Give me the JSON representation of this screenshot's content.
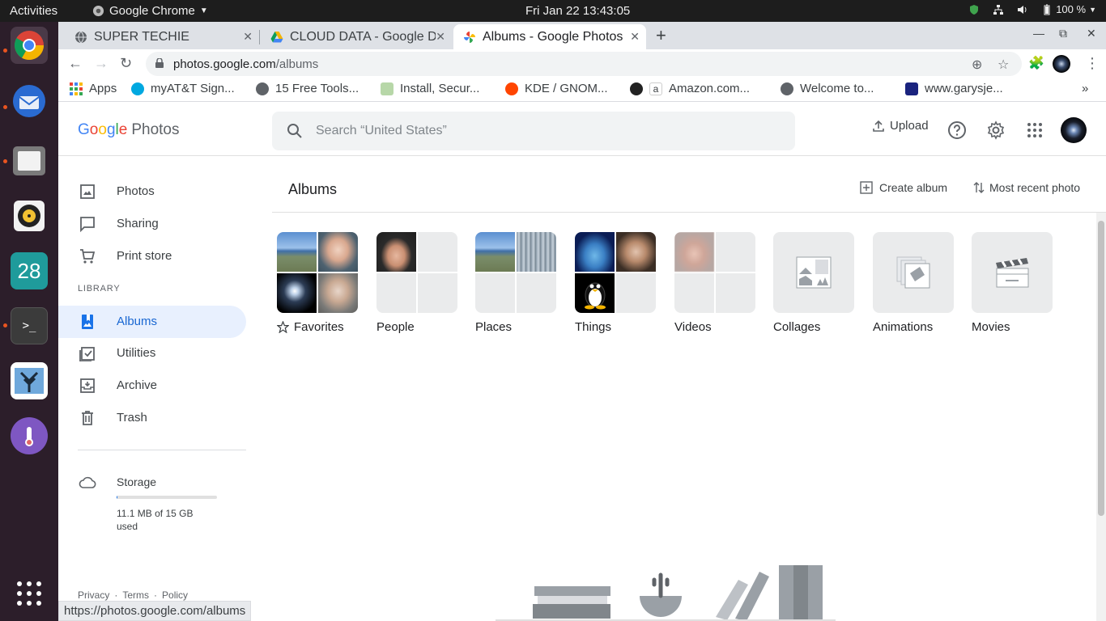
{
  "system": {
    "activities": "Activities",
    "app_menu": "Google Chrome",
    "clock": "Fri Jan 22  13:43:05",
    "battery": "100 %"
  },
  "dock": {
    "items": [
      "chrome-icon",
      "thunderbird-icon",
      "files-icon",
      "rhythmbox-icon",
      "calendar-icon",
      "terminal-icon",
      "photos-tree-icon",
      "thermometer-icon"
    ],
    "calendar_day": "28"
  },
  "tabs": [
    {
      "title": "SUPER TECHIE"
    },
    {
      "title": "CLOUD DATA - Google Drive"
    },
    {
      "title": "Albums - Google Photos"
    }
  ],
  "toolbar": {
    "url_host": "photos.google.com",
    "url_path": "/albums"
  },
  "bookmarks": [
    {
      "label": "Apps"
    },
    {
      "label": "myAT&T Sign..."
    },
    {
      "label": "15 Free Tools..."
    },
    {
      "label": "Install, Secur..."
    },
    {
      "label": "KDE / GNOM..."
    },
    {
      "label": "Amazon.com..."
    },
    {
      "label": "Welcome to..."
    },
    {
      "label": "www.garysje..."
    }
  ],
  "header": {
    "logo_g": [
      "G",
      "o",
      "o",
      "g",
      "l",
      "e"
    ],
    "logo_product": "Photos",
    "search_placeholder": "Search “United States”",
    "upload_label": "Upload"
  },
  "sidebar": {
    "items": [
      {
        "label": "Photos"
      },
      {
        "label": "Sharing"
      },
      {
        "label": "Print store"
      }
    ],
    "library_heading": "LIBRARY",
    "library_items": [
      {
        "label": "Albums"
      },
      {
        "label": "Utilities"
      },
      {
        "label": "Archive"
      },
      {
        "label": "Trash"
      }
    ],
    "storage_label": "Storage",
    "storage_used_fraction": 0.0007,
    "storage_text": "11.1 MB of 15 GB used",
    "footer": [
      "Privacy",
      "·",
      "Terms",
      "·",
      "Policy"
    ]
  },
  "main": {
    "title": "Albums",
    "create_album": "Create album",
    "sort": "Most recent photo",
    "albums": [
      {
        "label": "Favorites"
      },
      {
        "label": "People"
      },
      {
        "label": "Places"
      },
      {
        "label": "Things"
      },
      {
        "label": "Videos"
      },
      {
        "label": "Collages"
      },
      {
        "label": "Animations"
      },
      {
        "label": "Movies"
      }
    ]
  },
  "status_bar_url": "https://photos.google.com/albums"
}
